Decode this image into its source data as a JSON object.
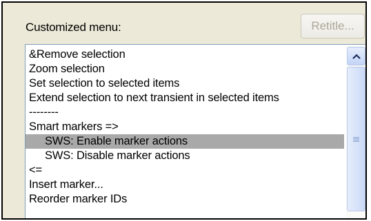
{
  "caption": "Customized menu:",
  "retitle_button": "Retitle...",
  "menu_items": [
    {
      "label": "&Remove selection",
      "indent": false,
      "selected": false
    },
    {
      "label": "Zoom selection",
      "indent": false,
      "selected": false
    },
    {
      "label": "Set selection to selected items",
      "indent": false,
      "selected": false
    },
    {
      "label": "Extend selection to next transient in selected items",
      "indent": false,
      "selected": false
    },
    {
      "label": "--------",
      "indent": false,
      "selected": false
    },
    {
      "label": "Smart markers =>",
      "indent": false,
      "selected": false
    },
    {
      "label": "SWS: Enable marker actions",
      "indent": true,
      "selected": true
    },
    {
      "label": "SWS: Disable marker actions",
      "indent": true,
      "selected": false
    },
    {
      "label": "<=",
      "indent": false,
      "selected": false
    },
    {
      "label": "Insert marker...",
      "indent": false,
      "selected": false
    },
    {
      "label": "Reorder marker IDs",
      "indent": false,
      "selected": false
    }
  ],
  "scrollbar": {
    "up_icon": "scroll-up-arrow",
    "thumb_icon": "scroll-thumb-grip"
  },
  "colors": {
    "selection": "#a9a9a9",
    "dialog_bg": "#ece9d8",
    "disabled_text": "#aca899"
  }
}
